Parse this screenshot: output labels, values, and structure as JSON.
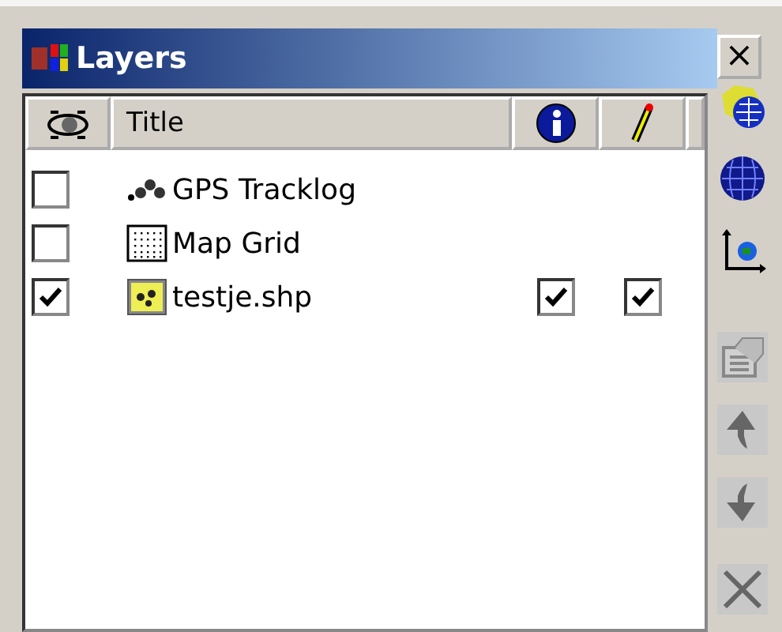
{
  "window": {
    "title": "Layers",
    "close_label": "×"
  },
  "columns": [
    {
      "kind": "visible"
    },
    {
      "kind": "title",
      "label": "Title"
    },
    {
      "kind": "info"
    },
    {
      "kind": "edit"
    },
    {
      "kind": "blank"
    }
  ],
  "layers": [
    {
      "name": "GPS Tracklog",
      "kind": "tracklog",
      "visible": false
    },
    {
      "name": "Map Grid",
      "kind": "grid",
      "visible": false
    },
    {
      "name": "testje.shp",
      "kind": "shape",
      "visible": true,
      "queryable": true,
      "editable": true
    }
  ],
  "toolbar": [
    {
      "kind": "add-layer",
      "disabled": false
    },
    {
      "kind": "globe",
      "disabled": false
    },
    {
      "kind": "projection",
      "disabled": false
    },
    {
      "kind": "properties",
      "disabled": true
    },
    {
      "kind": "up",
      "disabled": true
    },
    {
      "kind": "down",
      "disabled": true
    },
    {
      "kind": "remove",
      "disabled": true
    }
  ]
}
